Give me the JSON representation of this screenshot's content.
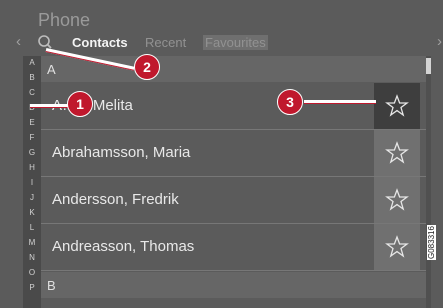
{
  "app": {
    "title": "Phone"
  },
  "nav": {
    "left_arrow": "‹",
    "right_arrow": "›"
  },
  "tabs": [
    {
      "label": "Contacts",
      "state": "active"
    },
    {
      "label": "Recent",
      "state": "inactive"
    },
    {
      "label": "Favourites",
      "state": "inactive"
    }
  ],
  "alphabet": [
    "A",
    "B",
    "C",
    "D",
    "E",
    "F",
    "G",
    "H",
    "I",
    "J",
    "K",
    "L",
    "M",
    "N",
    "O",
    "P"
  ],
  "sections": [
    {
      "letter": "A"
    },
    {
      "letter": "B"
    }
  ],
  "contacts": [
    {
      "name": "A…s, Melita",
      "favourite_selected": true
    },
    {
      "name": "Abrahamsson, Maria",
      "favourite_selected": false
    },
    {
      "name": "Andersson, Fredrik",
      "favourite_selected": false
    },
    {
      "name": "Andreasson, Thomas",
      "favourite_selected": false
    }
  ],
  "callouts": [
    "1",
    "2",
    "3"
  ],
  "figure_code": "G083316",
  "colors": {
    "callout": "#c0182d",
    "screen_bg": "#5b5b5b",
    "selected_fav_bg": "#3e3e3e"
  },
  "icons": {
    "search": "search-icon",
    "favourite": "star-outline-icon"
  }
}
